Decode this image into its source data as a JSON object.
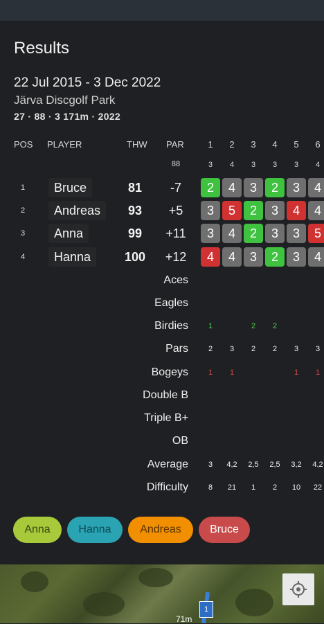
{
  "title": "Results",
  "date_range": "22 Jul 2015 - 3 Dec 2022",
  "course": "Järva Discgolf Park",
  "course_meta": "27 · 88 · 3 171m · 2022",
  "headers": {
    "pos": "POS",
    "player": "PLAYER",
    "thw": "THW",
    "par": "PAR"
  },
  "total_par": "88",
  "holes": [
    "1",
    "2",
    "3",
    "4",
    "5",
    "6"
  ],
  "hole_pars": [
    "3",
    "4",
    "3",
    "3",
    "3",
    "4"
  ],
  "players": [
    {
      "pos": "1",
      "name": "Bruce",
      "thw": "81",
      "par": "-7",
      "scores": [
        {
          "v": "2",
          "c": "green"
        },
        {
          "v": "4",
          "c": "neutral"
        },
        {
          "v": "3",
          "c": "neutral"
        },
        {
          "v": "2",
          "c": "green"
        },
        {
          "v": "3",
          "c": "neutral"
        },
        {
          "v": "4",
          "c": "neutral"
        }
      ]
    },
    {
      "pos": "2",
      "name": "Andreas",
      "thw": "93",
      "par": "+5",
      "scores": [
        {
          "v": "3",
          "c": "neutral"
        },
        {
          "v": "5",
          "c": "red"
        },
        {
          "v": "2",
          "c": "green"
        },
        {
          "v": "3",
          "c": "neutral"
        },
        {
          "v": "4",
          "c": "red"
        },
        {
          "v": "4",
          "c": "neutral"
        }
      ]
    },
    {
      "pos": "3",
      "name": "Anna",
      "thw": "99",
      "par": "+11",
      "scores": [
        {
          "v": "3",
          "c": "neutral"
        },
        {
          "v": "4",
          "c": "neutral"
        },
        {
          "v": "2",
          "c": "green"
        },
        {
          "v": "3",
          "c": "neutral"
        },
        {
          "v": "3",
          "c": "neutral"
        },
        {
          "v": "5",
          "c": "red"
        }
      ]
    },
    {
      "pos": "4",
      "name": "Hanna",
      "thw": "100",
      "par": "+12",
      "scores": [
        {
          "v": "4",
          "c": "red"
        },
        {
          "v": "4",
          "c": "neutral"
        },
        {
          "v": "3",
          "c": "neutral"
        },
        {
          "v": "2",
          "c": "green"
        },
        {
          "v": "3",
          "c": "neutral"
        },
        {
          "v": "4",
          "c": "neutral"
        }
      ]
    }
  ],
  "stats": [
    {
      "label": "Aces",
      "values": [
        "",
        "",
        "",
        "",
        "",
        ""
      ],
      "color": ""
    },
    {
      "label": "Eagles",
      "values": [
        "",
        "",
        "",
        "",
        "",
        ""
      ],
      "color": ""
    },
    {
      "label": "Birdies",
      "values": [
        "1",
        "",
        "2",
        "2",
        "",
        ""
      ],
      "color": "green"
    },
    {
      "label": "Pars",
      "values": [
        "2",
        "3",
        "2",
        "2",
        "3",
        "3"
      ],
      "color": ""
    },
    {
      "label": "Bogeys",
      "values": [
        "1",
        "1",
        "",
        "",
        "1",
        "1"
      ],
      "color": "red"
    },
    {
      "label": "Double B",
      "values": [
        "",
        "",
        "",
        "",
        "",
        ""
      ],
      "color": ""
    },
    {
      "label": "Triple B+",
      "values": [
        "",
        "",
        "",
        "",
        "",
        ""
      ],
      "color": ""
    },
    {
      "label": "OB",
      "values": [
        "",
        "",
        "",
        "",
        "",
        ""
      ],
      "color": ""
    },
    {
      "label": "Average",
      "values": [
        "3",
        "4,2",
        "2,5",
        "2,5",
        "3,2",
        "4,2"
      ],
      "color": ""
    },
    {
      "label": "Difficulty",
      "values": [
        "8",
        "21",
        "1",
        "2",
        "10",
        "22"
      ],
      "color": ""
    }
  ],
  "chips": [
    {
      "label": "Anna",
      "bg": "#a7c93a",
      "fg": "#3a4a10"
    },
    {
      "label": "Hanna",
      "bg": "#2aa3b3",
      "fg": "#0e4b53"
    },
    {
      "label": "Andreas",
      "bg": "#f28f00",
      "fg": "#5a3200"
    },
    {
      "label": "Bruce",
      "bg": "#c94a4a",
      "fg": "#ffffff"
    }
  ],
  "map": {
    "distance_label": "71m",
    "pin_label": "1"
  },
  "colors": {
    "green": "#3fc23f",
    "red": "#d03232",
    "neutral": "#6f6f6f"
  }
}
